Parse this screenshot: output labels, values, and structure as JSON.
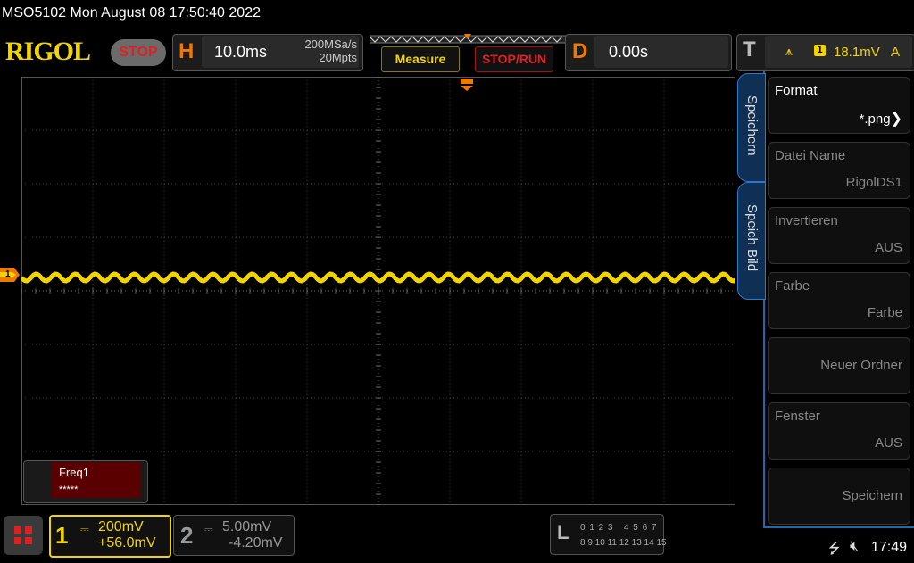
{
  "title_bar": "MSO5102  Mon August 08 17:50:40 2022",
  "brand": "RIGOL",
  "run_state": "STOP",
  "horizontal": {
    "letter": "H",
    "timebase": "10.0ms",
    "sample_rate": "200MSa/s",
    "memory_depth": "20Mpts"
  },
  "buttons": {
    "measure": "Measure",
    "stop_run": "STOP/RUN"
  },
  "delay": {
    "letter": "D",
    "value": "0.00s"
  },
  "trigger": {
    "letter": "T",
    "source": "1",
    "level": "18.1mV",
    "mode": "A"
  },
  "channel_marker": "1",
  "measurement": {
    "label": "Freq1",
    "value": "*****"
  },
  "menu": {
    "tabs": [
      "Speichern",
      "Speich Bild"
    ],
    "items": [
      {
        "label": "Format",
        "value": "*.png",
        "active": true
      },
      {
        "label": "Datei Name",
        "value": "RigolDS1",
        "active": false
      },
      {
        "label": "Invertieren",
        "value": "AUS",
        "active": false
      },
      {
        "label": "Farbe",
        "value": "Farbe",
        "active": false
      },
      {
        "label": "",
        "value": "Neuer Ordner",
        "active": false
      },
      {
        "label": "Fenster",
        "value": "AUS",
        "active": false
      },
      {
        "label": "",
        "value": "Speichern",
        "active": false
      }
    ]
  },
  "channels": [
    {
      "num": "1",
      "scale": "200mV",
      "offset": "+56.0mV",
      "color": "#f2d400"
    },
    {
      "num": "2",
      "scale": "5.00mV",
      "offset": "-4.20mV",
      "color": "#999999"
    }
  ],
  "logic": {
    "letter": "L",
    "row1": "0 1 2 3   4 5 6 7",
    "row2": "8 9 10 11 12 13 14 15"
  },
  "clock": "17:49",
  "colors": {
    "ch1": "#f2d400",
    "accent": "#f07800",
    "menu_border": "#1a6ab5"
  }
}
